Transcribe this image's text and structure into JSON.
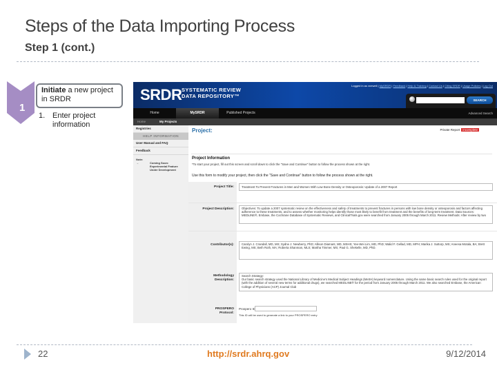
{
  "slide": {
    "title": "Steps of the Data Importing Process",
    "subtitle": "Step 1 (cont.)"
  },
  "step": {
    "number": "1",
    "callout_bold": "Initiate",
    "callout_rest": " a new project in SRDR",
    "substep_num": "1.",
    "substep_text": "Enter project information"
  },
  "srdr": {
    "logo": "SRDR",
    "logo_line1": "SYSTEMATIC REVIEW",
    "logo_line2": "DATA REPOSITORY™",
    "logged_in_prefix": "Logged in as vnewell | ",
    "top_links": [
      "MySRDR",
      "Feedback",
      "Help & Training",
      "Contact Us",
      "Citing SRDR",
      "Usage Policies",
      "Log Out"
    ],
    "search_button": "SEARCH",
    "search_value": "",
    "advanced_search": "Advanced Search",
    "nav": [
      "Home",
      "MySRDR",
      "Published Projects"
    ],
    "breadcrumbs": [
      "Home",
      "My Projects"
    ],
    "sidebar": {
      "items_top": [
        "Registries"
      ],
      "help_header": "HELP INFORMATION",
      "items_help": [
        "User Manual and FAQ",
        "Feedback"
      ],
      "note_label": "Note:",
      "note_symbol": "→",
      "note_text": "Coming Soon: Experimental Feature Under Development"
    },
    "project_heading": "Project:",
    "private_report": "Private Report",
    "status_badge": "incomplete",
    "project_info_heading": "Project Information",
    "project_info_note": "*To start your project, fill out this screen and scroll down to click the \"Save and Continue\" button to follow the process shown at the right.",
    "use_form_note": "Use this form to modify your project, then click the \"Save and Continue\" button to follow the process shown at the right.",
    "fields": {
      "title_label": "Project Title:",
      "title_value": "Treatment To Prevent Fractures in Men and Women With Low Bone Density or Osteoporosis: Update of a 2007 Report",
      "description_label": "Project Description:",
      "description_value": "Objectives: To update a 2007 systematic review on the effectiveness and safety of treatments to prevent fractures in persons with low bone density or osteoporosis and factors affecting adherence to these treatments, and to assess whether monitoring helps identify those most likely to benefit from treatment and the benefits of long-term treatment. Data Sources: MEDLINE®, Embase, the Cochrane Database of Systematic Reviews, and ClinicalTrials.gov were searched from January 2005 through March 2011. Review Methods: After review by two",
      "contributors_label": "Contributor(s):",
      "contributors_value": "Carolyn J. Crandall, MD, MS; Sydne J. Newberry, PhD; Allison Diamant, MD, MSHS; Yee-Wei Lim, MD, PhD; Walid F. Gellad, MD, MPH; Marika J. Suttorp, MS; Aneesa Motala, BA; Brett Ewing, MS; Beth Roth, MA; Roberta Shanman, MLS; Martha Timmer, MS; Paul G. Shekelle, MD, PhD.",
      "methodology_label_1": "Methodology",
      "methodology_label_2": "Description:",
      "methodology_value": "Search Strategy:\nOur basic search strategy used the National Library of Medicine's Medical Subject Headings (MeSH) keyword nomenclature. Using the same basic search rules used for the original report (with the addition of several new terms for additional drugs), we searched MEDLINE® for the period from January 2005 through March 2011. We also searched Embase, the American College of Physicians (ACP) Journal Club",
      "prospero_label_1": "PROSPERO",
      "prospero_label_2": "Protocol:",
      "prospero_id_label": "Prospero ID:",
      "prospero_id_value": "",
      "prospero_help": "This ID will be used to generate a link to your PROSPERO entry"
    }
  },
  "footer": {
    "page": "22",
    "url": "http://srdr.ahrq.gov",
    "date": "9/12/2014"
  },
  "colors": {
    "accent_purple": "#a58dc4",
    "srdr_blue": "#0d48a8",
    "footer_url": "#e07a1f",
    "badge_red": "#d62c2c"
  }
}
